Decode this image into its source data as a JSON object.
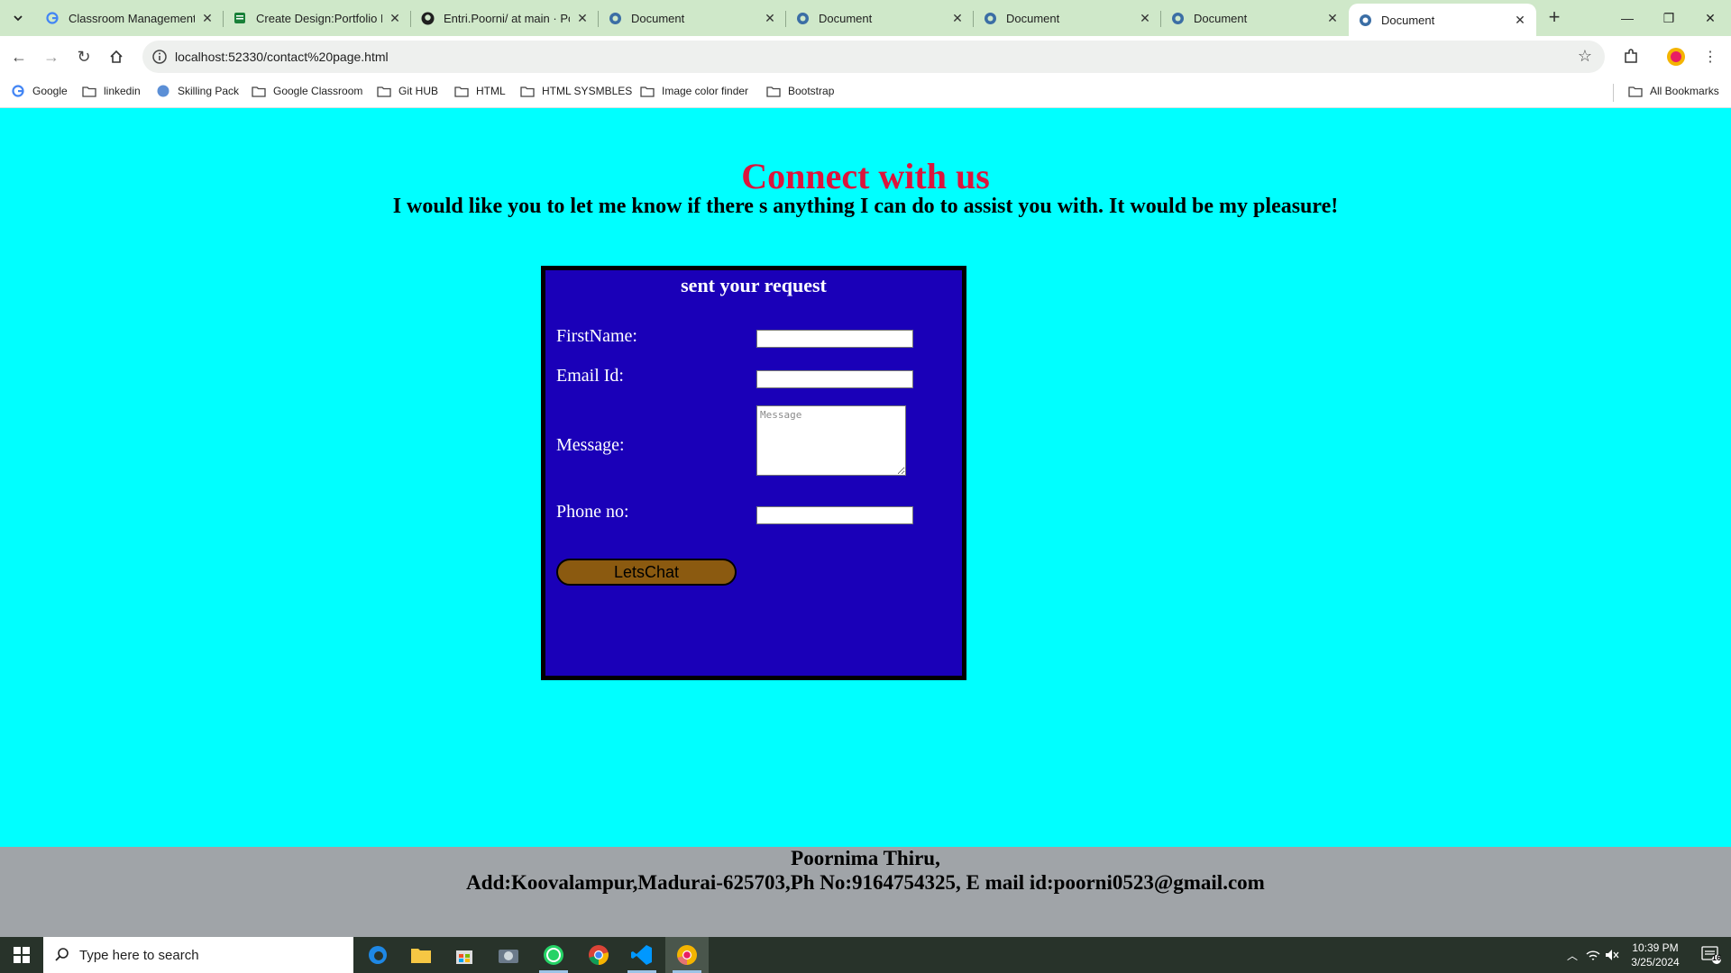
{
  "browser": {
    "tabs": [
      {
        "title": "Classroom Management T",
        "icon": "google-icon"
      },
      {
        "title": "Create Design:Portfolio H",
        "icon": "sheets-icon"
      },
      {
        "title": "Entri.Poorni/ at main · Poo",
        "icon": "github-icon"
      },
      {
        "title": "Document",
        "icon": "globe-icon"
      },
      {
        "title": "Document",
        "icon": "globe-icon"
      },
      {
        "title": "Document",
        "icon": "globe-icon"
      },
      {
        "title": "Document",
        "icon": "globe-icon"
      },
      {
        "title": "Document",
        "icon": "globe-icon",
        "active": true
      }
    ],
    "url": "localhost:52330/contact%20page.html",
    "bookmarks": [
      {
        "label": "Google",
        "icon": "google-icon"
      },
      {
        "label": "linkedin",
        "icon": "folder-icon"
      },
      {
        "label": "Skilling Pack",
        "icon": "site-icon"
      },
      {
        "label": "Google Classroom",
        "icon": "folder-icon"
      },
      {
        "label": "Git HUB",
        "icon": "folder-icon"
      },
      {
        "label": "HTML",
        "icon": "folder-icon"
      },
      {
        "label": "HTML SYSMBLES",
        "icon": "folder-icon"
      },
      {
        "label": "Image color finder",
        "icon": "folder-icon"
      },
      {
        "label": "Bootstrap",
        "icon": "folder-icon"
      }
    ],
    "all_bookmarks": "All Bookmarks"
  },
  "page": {
    "heading": "Connect with us",
    "subheading": "I would like you to let me know if there s anything I can do to assist you with. It would be my pleasure!",
    "form": {
      "title": "sent your request",
      "firstname_label": "FirstName:",
      "email_label": "Email Id:",
      "message_label": "Message:",
      "message_placeholder": "Message",
      "phone_label": "Phone no:",
      "submit_label": "LetsChat"
    },
    "footer": {
      "name": "Poornima Thiru,",
      "address": "Add:Koovalampur,Madurai-625703,Ph No:9164754325, E mail id:poorni0523@gmail.com"
    }
  },
  "taskbar": {
    "search_placeholder": "Type here to search",
    "time": "10:39 PM",
    "date": "3/25/2024",
    "notification_count": "16"
  },
  "colors": {
    "page_background": "#00ffff",
    "heading": "#dc143c",
    "form_background": "#1a00b8",
    "button": "#8b5a10",
    "footer_background": "#a0a4a8"
  }
}
